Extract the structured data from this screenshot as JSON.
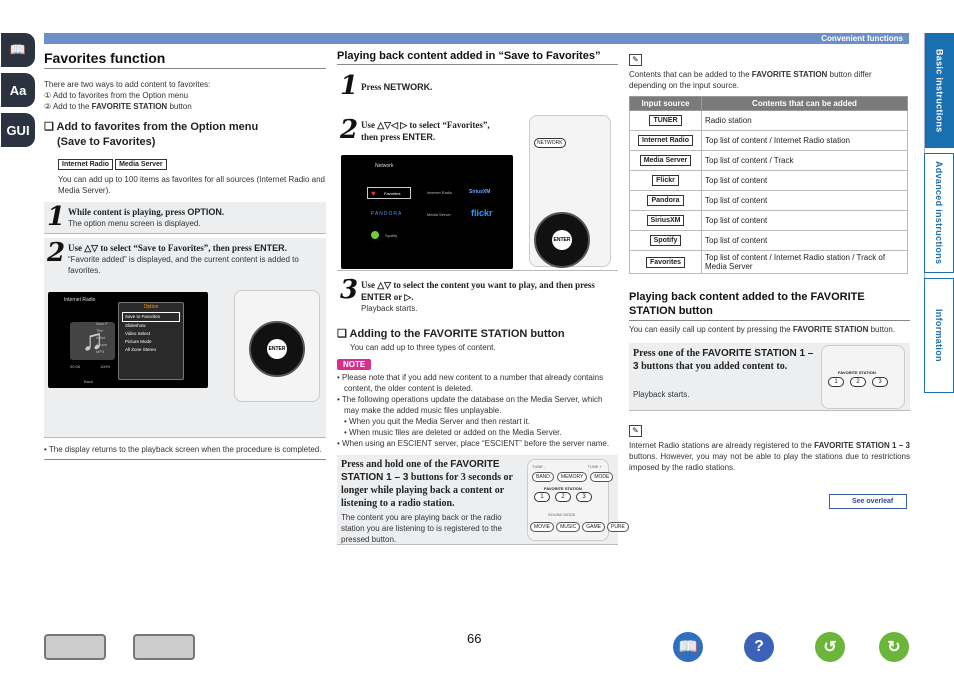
{
  "header": {
    "section": "Convenient functions"
  },
  "left_icons": [
    "book-icon",
    "aa-icon",
    "gui-icon"
  ],
  "left_icon_labels": {
    "aa": "Aa",
    "gui": "GUI"
  },
  "right_tabs": [
    {
      "label": "Basic instructions",
      "color": "#1a6fb0"
    },
    {
      "label": "Advanced instructions",
      "color": "#1a6fb0"
    },
    {
      "label": "Information",
      "color": "#1a6fb0"
    }
  ],
  "col1": {
    "title": "Favorites function",
    "intro": "There are two ways to add content to favorites:",
    "way1": "① Add to favorites from the Option menu",
    "way2_pre": "② Add to the ",
    "way2_bold": "FAVORITE STATION",
    "way2_post": " button",
    "sub_heading_1": "❑ Add to favorites from the Option menu",
    "sub_heading_2": "(Save to Favorites)",
    "tags": [
      "Internet Radio",
      "Media Server"
    ],
    "sub_desc": "You can add up to 100 items as favorites for all sources (Internet Radio and Media Server).",
    "step1_title_pre": "While content is playing, press ",
    "step1_title_bold": "OPTION",
    "step1_desc": "The option menu screen is displayed.",
    "step2_title_pre": "Use △▽ to select “Save to Favorites”, then press ",
    "step2_title_bold": "ENTER",
    "step2_desc": "“Favorite added” is displayed, and the current content is added to favorites.",
    "screen": {
      "source": "Internet Radio",
      "menu_title": "Option",
      "menu_items": [
        "Save to Favorites",
        "Slideshow",
        "Video Select",
        "Picture Mode",
        "All Zone Stereo"
      ],
      "time": "00:06",
      "percent": "100%",
      "back": "Back",
      "side_labels": [
        "Now P",
        "Title",
        "Artist",
        "Album",
        "MP3"
      ]
    },
    "note": "• The display returns to the playback screen when the procedure is completed."
  },
  "col2": {
    "title": "Playing back content added in “Save to Favorites”",
    "step1_pre": "Press ",
    "step1_bold": "NETWORK",
    "step2_text": "Use △▽◁ ▷ to select “Favorites”, then press ",
    "step2_bold": "ENTER",
    "screen": {
      "title": "Network",
      "items": [
        "Favorites",
        "Internet Radio",
        "SiriusXM",
        "PANDORA",
        "Media Server",
        "flickr",
        "Spotify"
      ]
    },
    "step3_text": "Use △▽ to select the content you want to play, and then press ",
    "step3_bold": "ENTER",
    "step3_tail": " or ▷.",
    "step3_desc": "Playback starts.",
    "sub_heading": "❑ Adding to the FAVORITE STATION button",
    "sub_desc": "You can add up to three types of content.",
    "note_badge": "NOTE",
    "notes": [
      "• Please note that if you add new content to a number that already contains content, the older content is deleted.",
      "• The following operations update the database on the Media Server, which may make the added music files unplayable.",
      "• When you quit the Media Server and then restart it.",
      "• When music files are deleted or added on the Media Server.",
      "• When using an ESCIENT server, place “ESCIENT” before the server name."
    ],
    "box_text_pre": "Press and hold one of the ",
    "box_text_bold": "FAVORITE STATION 1 – 3",
    "box_text_post": " buttons for 3 seconds or longer while playing back a content or listening to a radio station.",
    "box_desc": "The content you are playing back or the radio station you are listening to is registered to the pressed button.",
    "remote_label": "FAVORITE STATION",
    "remote_nums": [
      "1",
      "2",
      "3"
    ],
    "remote_labels_top": [
      "TUNE -",
      "TUNE +"
    ],
    "remote_labels_mid": [
      "BAND",
      "MEMORY",
      "MODE"
    ],
    "remote_labels_bot": [
      "MOVIE",
      "MUSIC",
      "GAME",
      "PURE"
    ],
    "remote_mode_label": "SOUND MODE"
  },
  "col3": {
    "intro_pre": "Contents that can be added to the ",
    "intro_bold": "FAVORITE STATION",
    "intro_post": " button differ depending on the input source.",
    "table_head": [
      "Input source",
      "Contents that can be added"
    ],
    "table_rows": [
      {
        "src": "TUNER",
        "content": "Radio station"
      },
      {
        "src": "Internet Radio",
        "content": "Top list of content / Internet Radio station"
      },
      {
        "src": "Media Server",
        "content": "Top list of content / Track"
      },
      {
        "src": "Flickr",
        "content": "Top list of content"
      },
      {
        "src": "Pandora",
        "content": "Top list of content"
      },
      {
        "src": "SiriusXM",
        "content": "Top list of content"
      },
      {
        "src": "Spotify",
        "content": "Top list of content"
      },
      {
        "src": "Favorites",
        "content": "Top list of content / Internet Radio station / Track of Media Server"
      }
    ],
    "title": "Playing back content added to the FAVORITE STATION button",
    "desc_pre": "You can easily call up content by pressing the ",
    "desc_bold": "FAVORITE STATION",
    "desc_post": " button.",
    "box_pre": "Press one of the ",
    "box_bold": "FAVORITE STATION 1 – 3",
    "box_post": " buttons that you added content to.",
    "box_desc": "Playback starts.",
    "tip_pre": "Internet Radio stations are already registered to the ",
    "tip_bold": "FAVORITE STATION 1 – 3",
    "tip_post": " buttons. However, you may not be able to play the stations due to restrictions imposed by the radio stations.",
    "see_overleaf": "See overleaf"
  },
  "footer": {
    "page": "66"
  }
}
